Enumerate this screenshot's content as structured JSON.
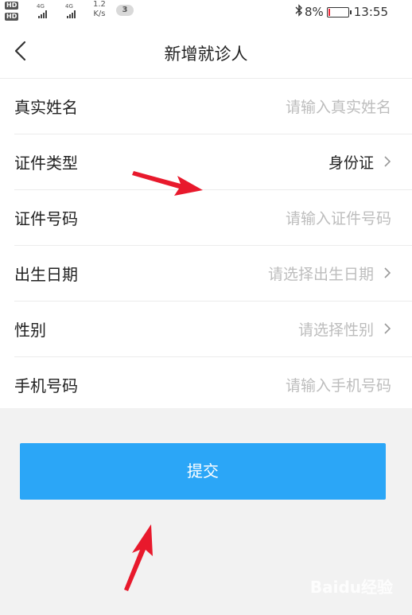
{
  "status_bar": {
    "net_labels": [
      "4G",
      "4G"
    ],
    "speed_value": "1.2",
    "speed_unit": "K/s",
    "notification_count": "3",
    "battery_text": "8%",
    "battery_level": 0.08,
    "time": "13:55"
  },
  "header": {
    "title": "新增就诊人"
  },
  "form": {
    "rows": [
      {
        "label": "真实姓名",
        "value": "请输入真实姓名"
      },
      {
        "label": "证件类型",
        "value": "身份证"
      },
      {
        "label": "证件号码",
        "value": "请输入证件号码"
      },
      {
        "label": "出生日期",
        "value": "请选择出生日期"
      },
      {
        "label": "性别",
        "value": "请选择性别"
      },
      {
        "label": "手机号码",
        "value": "请输入手机号码"
      }
    ]
  },
  "submit_label": "提交",
  "watermark": "Baidu经验",
  "colors": {
    "accent": "#2ba6f7",
    "annotation_arrow": "#e8192c"
  }
}
